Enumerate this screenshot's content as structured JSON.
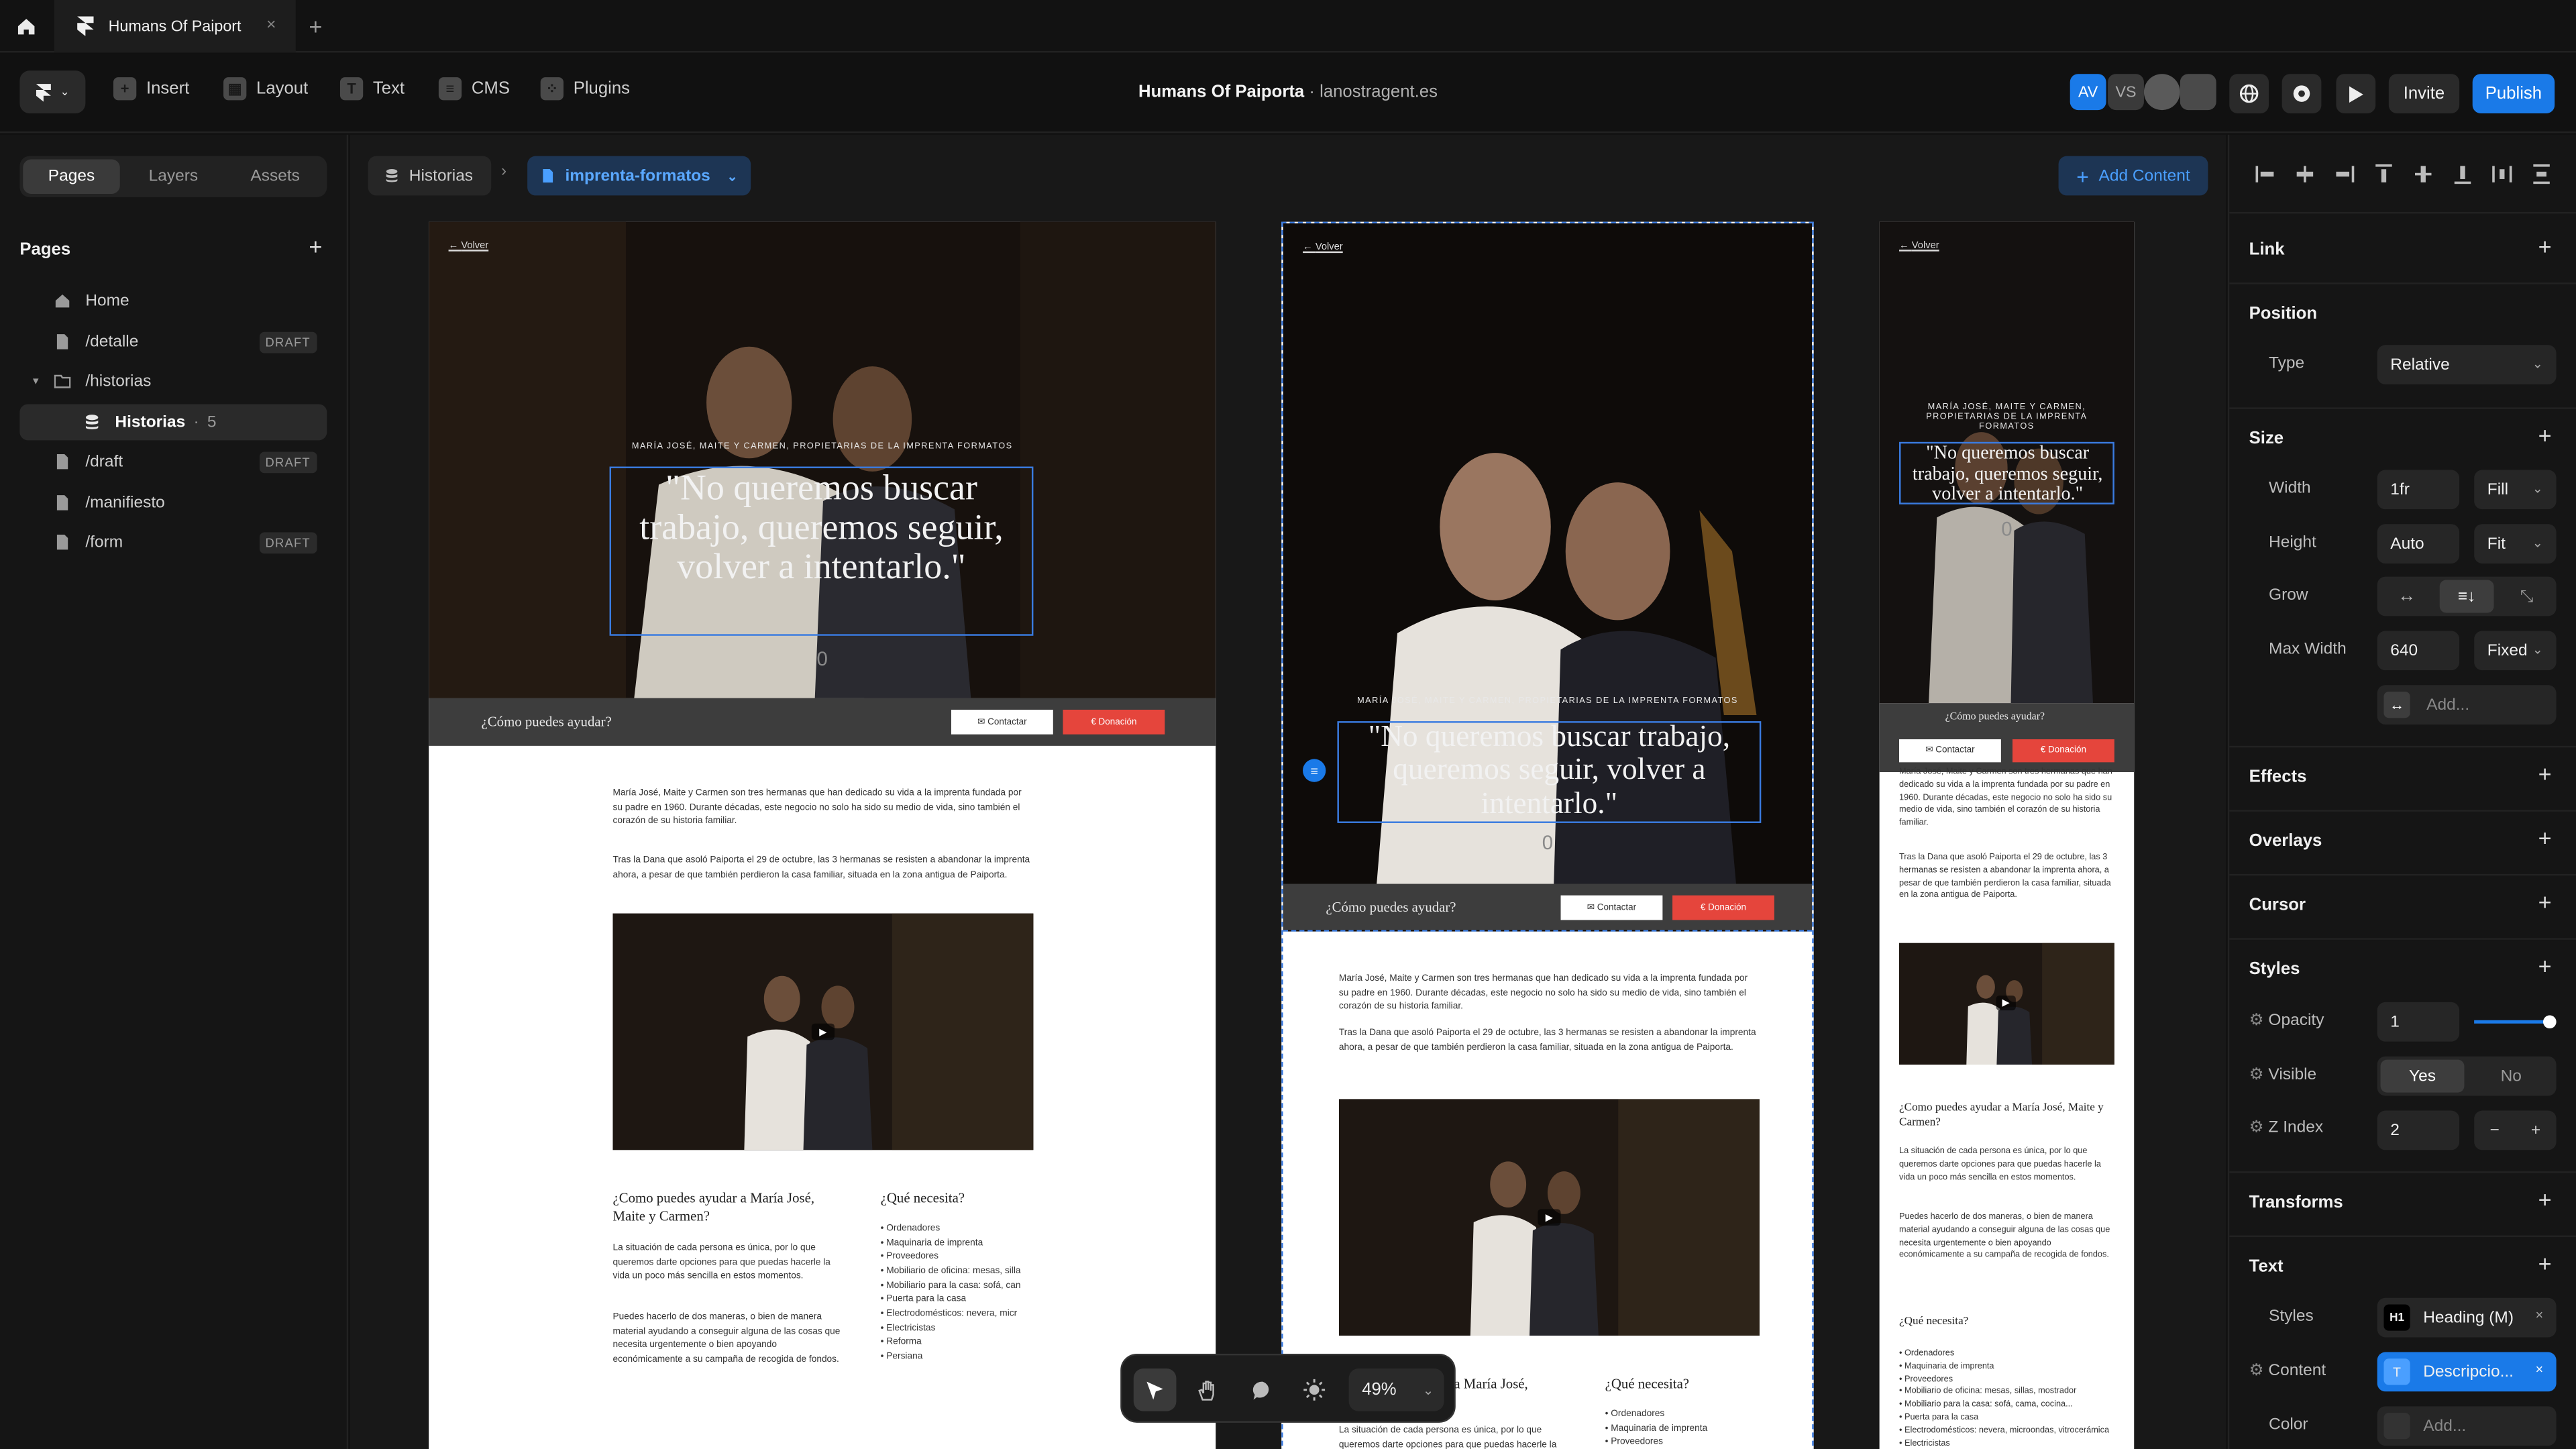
{
  "tabbar": {
    "doc_tab": "Humans Of Paiport",
    "close": "×",
    "new_tab": "+"
  },
  "toolbar": {
    "insert": "Insert",
    "layout": "Layout",
    "text": "Text",
    "cms": "CMS",
    "plugins": "Plugins",
    "project_name": "Humans Of Paiporta",
    "separator": "·",
    "domain": "lanostragent.es",
    "avatars": [
      {
        "initials": "AV",
        "color": "#1a7ae8"
      },
      {
        "initials": "VS",
        "color": "#3a3a3a"
      }
    ],
    "invite": "Invite",
    "publish": "Publish"
  },
  "left_panel": {
    "tabs": [
      "Pages",
      "Layers",
      "Assets"
    ],
    "active_tab": "Pages",
    "section_title": "Pages",
    "add": "+",
    "pages": [
      {
        "label": "Home",
        "draft": ""
      },
      {
        "label": "/detalle",
        "draft": "DRAFT"
      },
      {
        "label": "/historias",
        "draft": ""
      },
      {
        "label": "Historias",
        "count": "5",
        "draft": ""
      },
      {
        "label": "/draft",
        "draft": "DRAFT"
      },
      {
        "label": "/manifiesto",
        "draft": ""
      },
      {
        "label": "/form",
        "draft": "DRAFT"
      }
    ],
    "count_sep": "·"
  },
  "canvas": {
    "breadcrumb": {
      "parent": "Historias",
      "sep": "›",
      "current": "imprenta-formatos"
    },
    "add_content": "Add Content",
    "page": {
      "back": "Volver",
      "kicker": "MARÍA JOSÉ, MAITE Y CARMEN, PROPIETARIAS DE LA IMPRENTA FORMATOS",
      "quote": "\"No queremos buscar trabajo, queremos seguir, volver a intentarlo.\"",
      "zero": "0",
      "help": "¿Cómo puedes ayudar?",
      "contact": "✉ Contactar",
      "donate": "€ Donación",
      "p1": "María José, Maite y Carmen son tres hermanas que han dedicado su vida a la imprenta fundada por su padre en 1960. Durante décadas, este negocio no solo ha sido su medio de vida, sino también el corazón de su historia familiar.",
      "p2": "Tras la Dana que asoló Paiporta el 29 de octubre, las 3 hermanas se resisten a abandonar la imprenta ahora, a pesar de que también perdieron la casa familiar, situada en la zona antigua de Paiporta.",
      "how_title": "¿Como puedes ayudar a María José, Maite y Carmen?",
      "how_short": "a María José,",
      "how_p1": "La situación de cada persona es única, por lo que queremos darte opciones para que puedas hacerle la vida un poco más sencilla en estos momentos.",
      "how_p2": "Puedes hacerlo de dos maneras, o bien de manera material ayudando a conseguir alguna de las cosas que necesita urgentemente o bien apoyando económicamente a su campaña de recogida de fondos.",
      "needs_title": "¿Qué necesita?",
      "needs": [
        "Ordenadores",
        "Maquinaria de imprenta",
        "Proveedores",
        "Mobiliario de oficina: mesas, sillas, mostrador",
        "Mobiliario para la casa: sofá, cama, cocina...",
        "Puerta para la casa",
        "Electrodomésticos: nevera, microondas, vitrocerámica",
        "Electricistas",
        "Reforma",
        "Persiana"
      ],
      "needs_short": [
        "Ordenadores",
        "Maquinaria de imprenta",
        "Proveedores",
        "Mobiliario de oficina: mesas, silla",
        "Mobiliario para la casa: sofá, can",
        "Puerta para la casa",
        "Electrodomésticos: nevera, micr",
        "Electricistas",
        "Reforma",
        "Persiana"
      ],
      "play": "▶"
    },
    "zoom": "49%"
  },
  "right_panel": {
    "link": "Link",
    "position": "Position",
    "type_label": "Type",
    "type_value": "Relative",
    "size": "Size",
    "width_label": "Width",
    "width_value": "1fr",
    "width_mode": "Fill",
    "height_label": "Height",
    "height_value": "Auto",
    "height_mode": "Fit",
    "grow_label": "Grow",
    "maxw_label": "Max Width",
    "maxw_value": "640",
    "maxw_mode": "Fixed",
    "add": "Add...",
    "effects": "Effects",
    "overlays": "Overlays",
    "cursor": "Cursor",
    "styles": "Styles",
    "opacity_label": "Opacity",
    "opacity_value": "1",
    "opacity_level": 1.0,
    "visible_label": "Visible",
    "visible_yes": "Yes",
    "visible_no": "No",
    "z_label": "Z Index",
    "z_value": "2",
    "minus": "−",
    "plus": "+",
    "transforms": "Transforms",
    "text": "Text",
    "styles_label": "Styles",
    "heading_badge": "H1",
    "heading_value": "Heading (M)",
    "content_label": "Content",
    "content_badge": "T",
    "content_value": "Descripcio...",
    "color_label": "Color",
    "color_value": "Add..."
  }
}
